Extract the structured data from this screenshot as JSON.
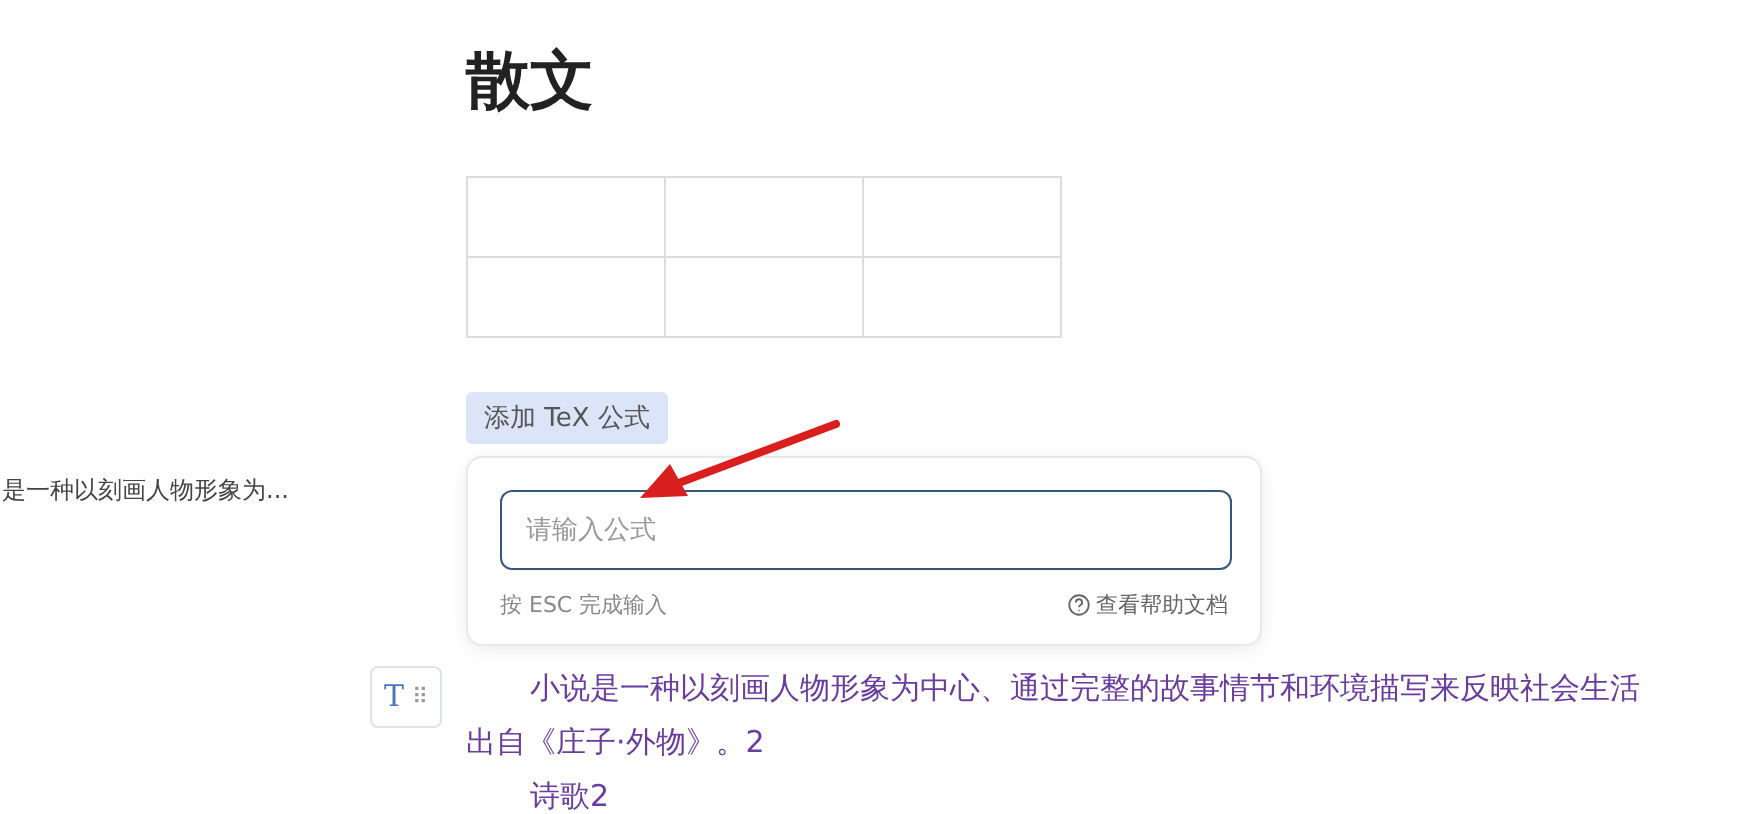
{
  "outline": {
    "items": [
      {
        "text": "是一种以刻画人物形象为..."
      }
    ]
  },
  "document": {
    "title": "散文",
    "table": {
      "rows": [
        [
          "",
          "",
          ""
        ],
        [
          "",
          "",
          ""
        ]
      ]
    },
    "formula_button": "添加 TeX 公式",
    "formula_popover": {
      "placeholder": "请输入公式",
      "hint": "按 ESC 完成输入",
      "help_link": "查看帮助文档"
    },
    "block_handle": {
      "type_icon": "T",
      "drag_icon": "⠿"
    },
    "paragraphs": [
      {
        "text": "小说是一种以刻画人物形象为中心、通过完整的故事情节和环境描写来反映社会生活",
        "indent": true
      },
      {
        "text": "出自《庄子·外物》。2",
        "indent": false
      },
      {
        "text": "诗歌2",
        "indent": true
      }
    ]
  }
}
